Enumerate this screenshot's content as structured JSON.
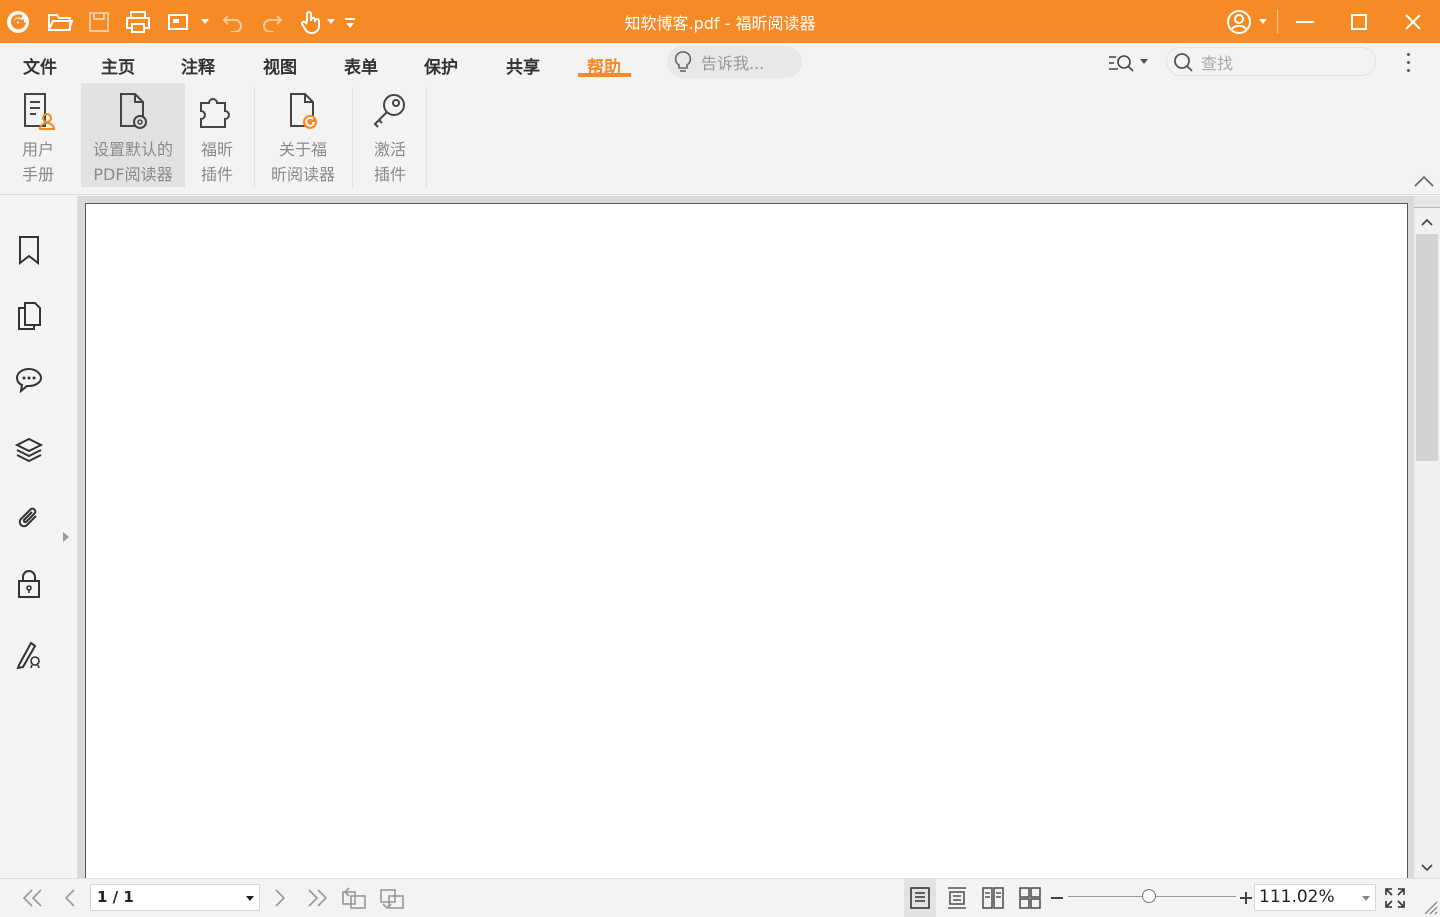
{
  "window": {
    "title": "知软博客.pdf - 福昕阅读器",
    "accent_color": "#f68a24"
  },
  "quick_access": [
    {
      "name": "app-logo-icon"
    },
    {
      "name": "open-folder-icon"
    },
    {
      "name": "save-icon"
    },
    {
      "name": "print-icon"
    },
    {
      "name": "screenshot-icon"
    },
    {
      "name": "undo-icon"
    },
    {
      "name": "redo-icon"
    },
    {
      "name": "hand-tool-icon"
    },
    {
      "name": "customize-toolbar-icon"
    }
  ],
  "menu": {
    "tabs": [
      {
        "label": "文件",
        "active": false
      },
      {
        "label": "主页",
        "active": false
      },
      {
        "label": "注释",
        "active": false
      },
      {
        "label": "视图",
        "active": false
      },
      {
        "label": "表单",
        "active": false
      },
      {
        "label": "保护",
        "active": false
      },
      {
        "label": "共享",
        "active": false
      },
      {
        "label": "帮助",
        "active": true
      }
    ],
    "tell_me_placeholder": "告诉我...",
    "find_placeholder": "查找"
  },
  "ribbon": {
    "buttons": [
      {
        "line1": "用户",
        "line2": "手册",
        "icon": "user-manual-icon",
        "selected": false
      },
      {
        "line1": "设置默认的",
        "line2": "PDF阅读器",
        "icon": "set-default-reader-icon",
        "selected": true
      },
      {
        "line1": "福昕",
        "line2": "插件",
        "icon": "plugin-icon",
        "selected": false
      },
      {
        "line1": "关于福",
        "line2": "昕阅读器",
        "icon": "about-icon",
        "selected": false
      },
      {
        "line1": "激活",
        "line2": "插件",
        "icon": "activate-key-icon",
        "selected": false
      }
    ]
  },
  "sidebar": {
    "icons": [
      "bookmark-icon",
      "pages-icon",
      "comments-icon",
      "layers-icon",
      "attachments-icon",
      "security-lock-icon",
      "signature-icon"
    ]
  },
  "status": {
    "page_display": "1 / 1",
    "zoom": "111.02%",
    "zoom_fraction": 0.48
  }
}
